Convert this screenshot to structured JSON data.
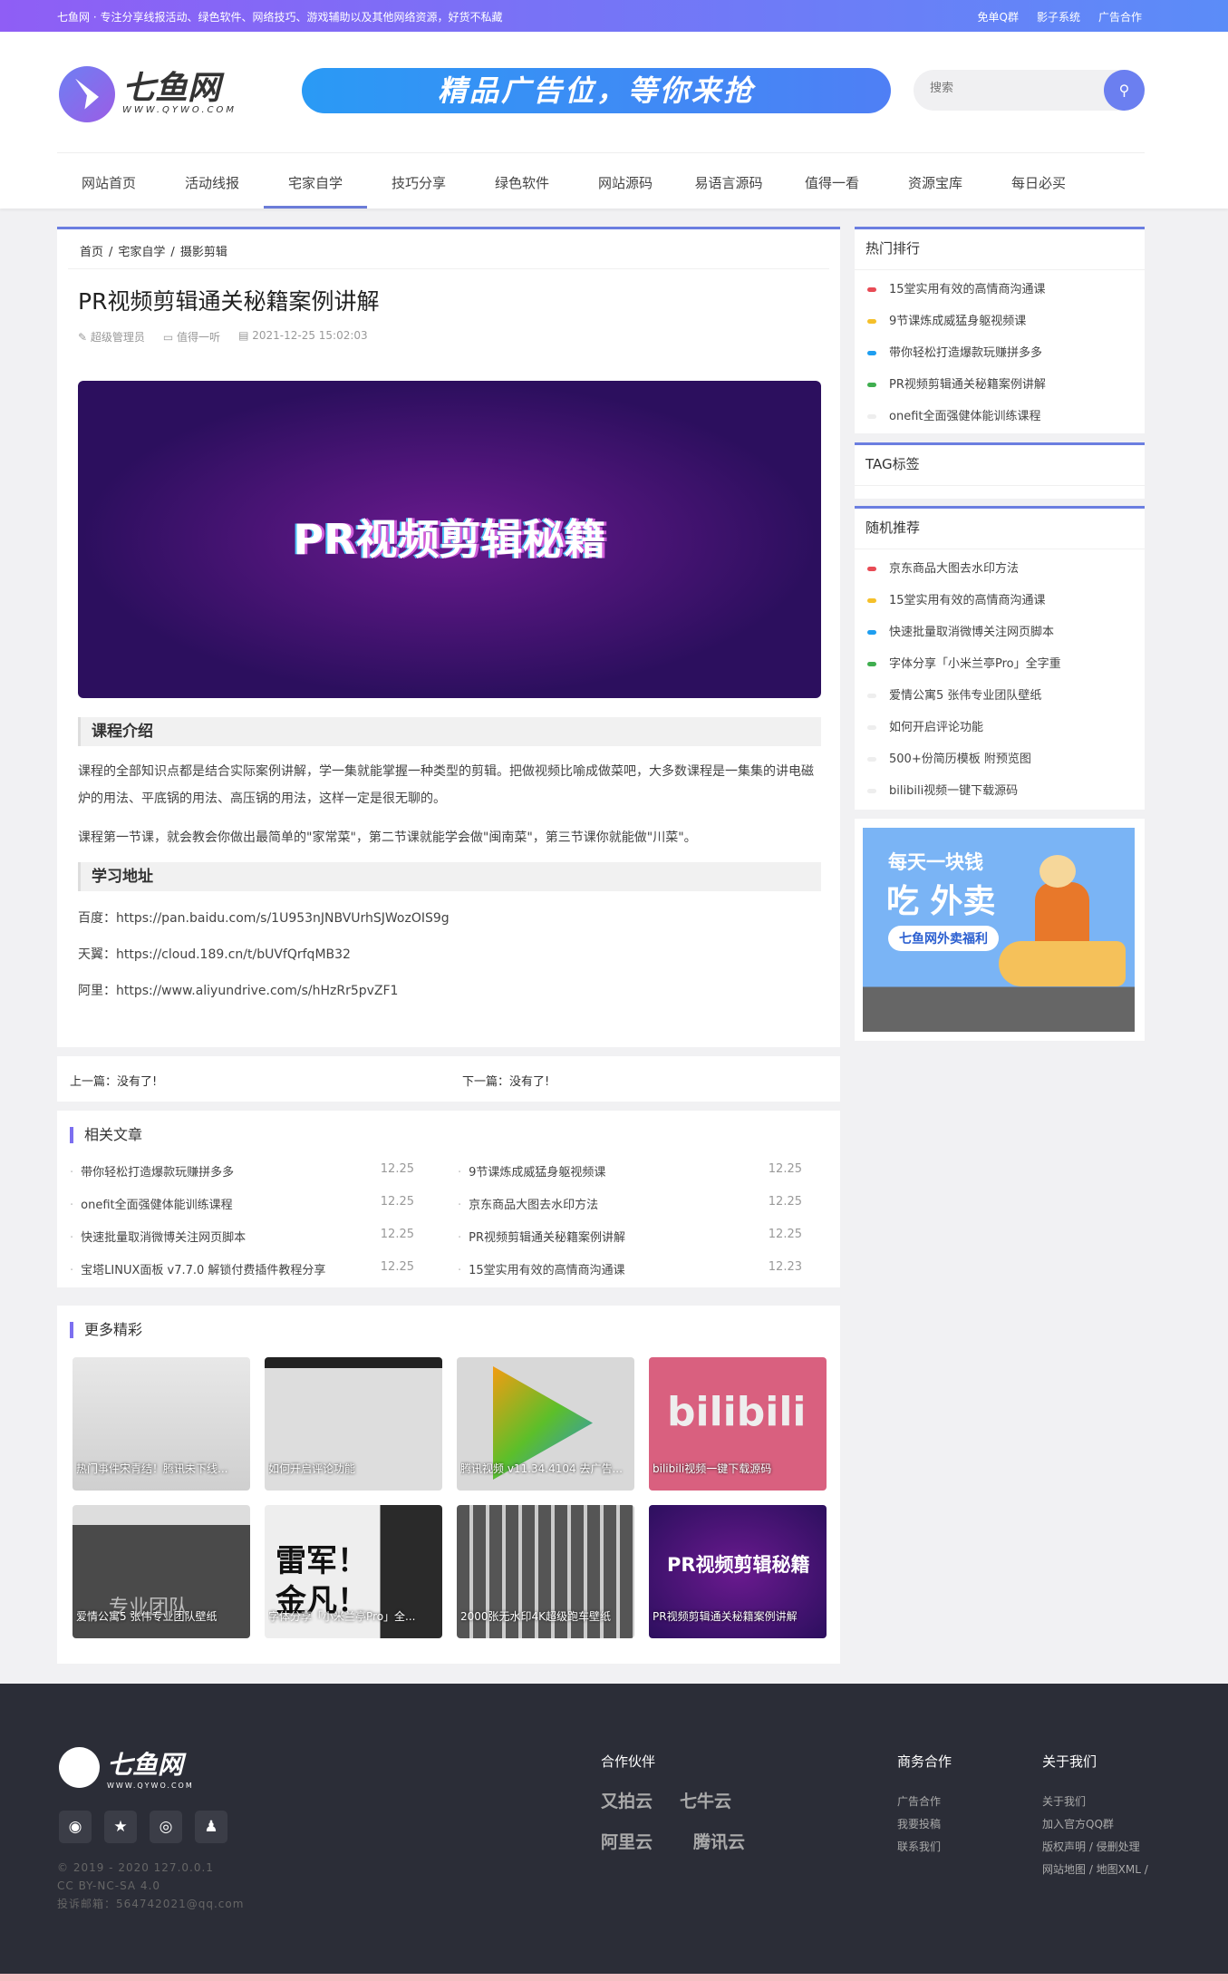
{
  "topbar": {
    "tagline": "七鱼网 · 专注分享线报活动、绿色软件、网络技巧、游戏辅助以及其他网络资源，好货不私藏",
    "links": [
      "免单Q群",
      "影子系统",
      "广告合作"
    ]
  },
  "header": {
    "logo_name": "七鱼网",
    "logo_url": "WWW.QYWO.COM",
    "ad_text": "精品广告位，等你来抢",
    "search_placeholder": "搜索"
  },
  "nav": {
    "items": [
      "网站首页",
      "活动线报",
      "宅家自学",
      "技巧分享",
      "绿色软件",
      "网站源码",
      "易语言源码",
      "值得一看",
      "资源宝库",
      "每日必买"
    ],
    "active": "宅家自学"
  },
  "article": {
    "breadcrumb": [
      "首页",
      "/",
      "宅家自学",
      "/",
      "摄影剪辑"
    ],
    "title": "PR视频剪辑通关秘籍案例讲解",
    "author": "超级管理员",
    "category": "值得一听",
    "date": "2021-12-25 15:02:03",
    "hero_text": "PR视频剪辑秘籍",
    "section1": "课程介绍",
    "para1": "课程的全部知识点都是结合实际案例讲解，学一集就能掌握一种类型的剪辑。把做视频比喻成做菜吧，大多数课程是一集集的讲电磁炉的用法、平底锅的用法、高压锅的用法，这样一定是很无聊的。",
    "para2": "课程第一节课，就会教会你做出最简单的\"家常菜\"，第二节课就能学会做\"闽南菜\"，第三节课你就能做\"川菜\"。",
    "section2": "学习地址",
    "links": [
      {
        "label": "百度：",
        "url": "https://pan.baidu.com/s/1U953nJNBVUrhSJWozOIS9g"
      },
      {
        "label": "天翼：",
        "url": "https://cloud.189.cn/t/bUVfQrfqMB32"
      },
      {
        "label": "阿里：",
        "url": "https://www.aliyundrive.com/s/hHzRr5pvZF1"
      }
    ]
  },
  "prevnext": {
    "prev": "上一篇：没有了!",
    "next": "下一篇：没有了!"
  },
  "related": {
    "title": "相关文章",
    "items": [
      {
        "t": "带你轻松打造爆款玩赚拼多多",
        "d": "12.25"
      },
      {
        "t": "9节课炼成威猛身躯视频课",
        "d": "12.25"
      },
      {
        "t": "onefit全面强健体能训练课程",
        "d": "12.25"
      },
      {
        "t": "京东商品大图去水印方法",
        "d": "12.25"
      },
      {
        "t": "快速批量取消微博关注网页脚本",
        "d": "12.25"
      },
      {
        "t": "PR视频剪辑通关秘籍案例讲解",
        "d": "12.25"
      },
      {
        "t": "宝塔LINUX面板 v7.7.0 解锁付费插件教程分享",
        "d": "12.25"
      },
      {
        "t": "15堂实用有效的高情商沟通课",
        "d": "12.23"
      }
    ]
  },
  "more": {
    "title": "更多精彩",
    "items": [
      "热门事件宋青结！腾讯未下线...",
      "如何开启评论功能",
      "腾讯视频 v11.34.4104 去广告...",
      "bilibili视频一键下载源码",
      "爱情公寓5 张伟专业团队壁纸",
      "字体分享「小米兰亭Pro」全...",
      "2000张无水印4K超级跑车壁纸",
      "PR视频剪辑通关秘籍案例讲解"
    ],
    "thumb_texts": {
      "bili": "bilibili",
      "team": "专业团队",
      "font": "雷军！金凡！",
      "pr": "PR视频剪辑秘籍"
    }
  },
  "sidebar": {
    "hot": {
      "title": "热门排行",
      "items": [
        "15堂实用有效的高情商沟通课",
        "9节课炼成威猛身躯视频课",
        "带你轻松打造爆款玩赚拼多多",
        "PR视频剪辑通关秘籍案例讲解",
        "onefit全面强健体能训练课程"
      ]
    },
    "tags": {
      "title": "TAG标签"
    },
    "random": {
      "title": "随机推荐",
      "items": [
        "京东商品大图去水印方法",
        "15堂实用有效的高情商沟通课",
        "快速批量取消微博关注网页脚本",
        "字体分享「小米兰亭Pro」全字重",
        "爱情公寓5 张伟专业团队壁纸",
        "如何开启评论功能",
        "500+份简历模板 附预览图",
        "bilibili视频一键下载源码"
      ]
    },
    "dot_colors": [
      "#e84b55",
      "#f5c02a",
      "#1e9ef0",
      "#3fae4f",
      "#eeeeee",
      "#eeeeee",
      "#eeeeee",
      "#eeeeee"
    ],
    "ad": {
      "line1": "每天一块钱",
      "line2": "吃 外卖",
      "badge": "七鱼网外卖福利"
    }
  },
  "footer": {
    "logo_name": "七鱼网",
    "logo_url": "WWW.QYWO.COM",
    "copy": [
      "© 2019 - 2020 127.0.0.1",
      "CC BY-NC-SA 4.0",
      "投诉邮箱：564742021@qq.com"
    ],
    "partners_title": "合作伙伴",
    "partners": [
      "又拍云",
      "七牛云",
      "阿里云",
      "腾讯云"
    ],
    "biz_title": "商务合作",
    "biz": [
      "广告合作",
      "我要投稿",
      "联系我们"
    ],
    "about_title": "关于我们",
    "about": [
      "关于我们",
      "加入官方QQ群",
      "版权声明 / 侵删处理",
      "网站地图 / 地图XML /"
    ]
  },
  "colors": {
    "accent": "#6b7ee0",
    "footer_bg": "#2b2d37"
  }
}
